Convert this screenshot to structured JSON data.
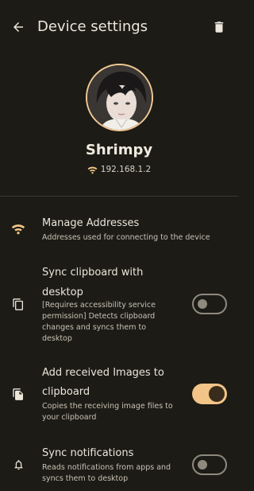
{
  "header": {
    "title": "Device settings",
    "back_icon": "arrow-back-icon",
    "delete_icon": "trash-icon"
  },
  "device": {
    "name": "Shrimpy",
    "ip": "192.168.1.2",
    "avatar": "avatar-photo"
  },
  "settings": [
    {
      "label": "Manage Addresses",
      "description": "Addresses used for connecting to the device",
      "icon": "wifi-icon"
    },
    {
      "label_line1": "Sync clipboard with",
      "label_line2": "desktop",
      "description_line1": "[Requires accessibility service",
      "description_line2": "permission] Detects clipboard",
      "description_line3": "changes and syncs them to",
      "description_line4": "desktop",
      "icon": "copy-icon",
      "toggle": false
    },
    {
      "label_line1": "Add received Images to",
      "label_line2": "clipboard",
      "description_line1": "Copies the receiving image files to",
      "description_line2": "your clipboard",
      "icon": "file-copy-icon",
      "toggle": true
    },
    {
      "label": "Sync notifications",
      "description_line1": "Reads notifications from apps and",
      "description_line2": "syncs them to desktop",
      "icon": "bell-icon",
      "toggle": false
    }
  ],
  "colors": {
    "background": "#1c1b16",
    "accent": "#f2c487",
    "text": "#ece6da"
  }
}
